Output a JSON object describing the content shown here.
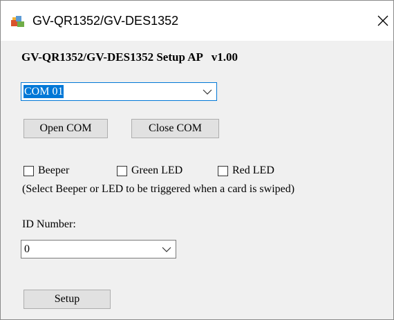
{
  "window": {
    "title": "GV-QR1352/GV-DES1352",
    "close_glyph": "✕",
    "icons": {
      "app": "app-setup-icon",
      "close": "close-icon"
    }
  },
  "main": {
    "heading": "GV-QR1352/GV-DES1352 Setup AP   v1.00",
    "com_port": {
      "selected": "COM 01",
      "icon": "chevron-down-icon"
    },
    "buttons": {
      "open_com": "Open COM",
      "close_com": "Close COM",
      "setup": "Setup"
    },
    "options": {
      "beeper": {
        "label": "Beeper",
        "checked": false
      },
      "green_led": {
        "label": "Green LED",
        "checked": false
      },
      "red_led": {
        "label": "Red LED",
        "checked": false
      }
    },
    "hint": "(Select Beeper or LED to be triggered when a card is swiped)",
    "id_number": {
      "label": "ID Number:",
      "selected": "0",
      "icon": "chevron-down-icon"
    }
  },
  "colors": {
    "selection": "#0078d7",
    "button_face": "#e1e1e1",
    "dialog_bg": "#f0f0f0"
  }
}
